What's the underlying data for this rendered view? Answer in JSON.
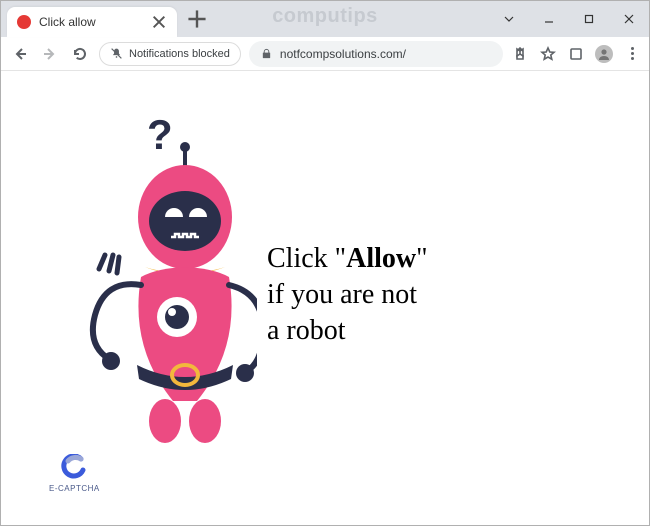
{
  "watermark": "computips",
  "titlebar": {
    "tab_title": "Click allow"
  },
  "toolbar": {
    "notifications_chip": "Notifications blocked",
    "url": "notfcompsolutions.com/"
  },
  "page": {
    "msg_prefix": "Click \"",
    "msg_strong": "Allow",
    "msg_suffix_line1": "\"",
    "msg_line2": "if you are not",
    "msg_line3": "a robot",
    "ecaptcha_label": "E-CAPTCHA"
  }
}
